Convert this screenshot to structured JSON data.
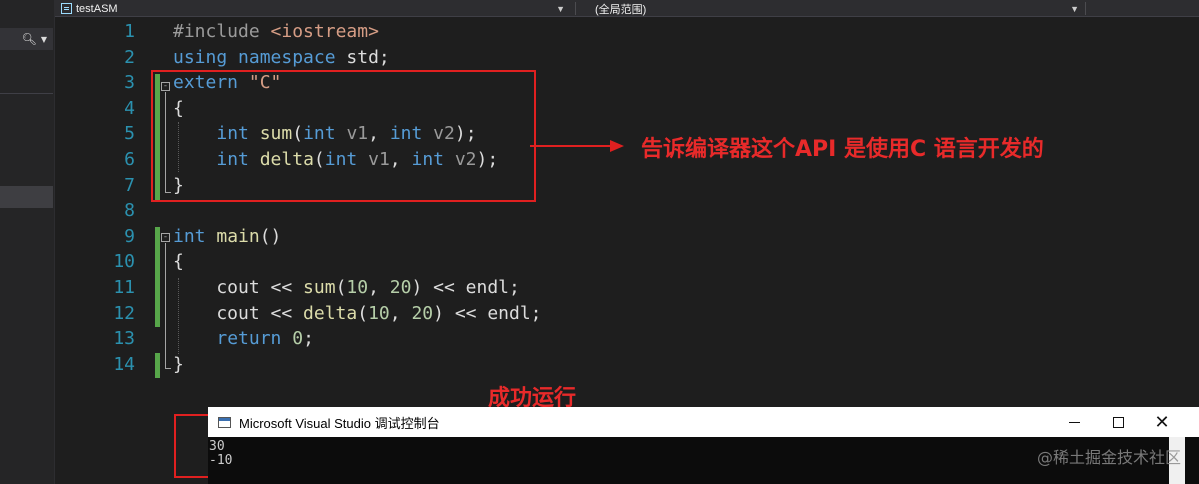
{
  "navbar": {
    "file_combo": "testASM",
    "scope_combo": "(全局范围)"
  },
  "code_lines": [
    {
      "num": "1",
      "tokens": [
        [
          "inc",
          "#include "
        ],
        [
          "str",
          "<iostream>"
        ]
      ]
    },
    {
      "num": "2",
      "tokens": [
        [
          "kw",
          "using"
        ],
        [
          "pl",
          " "
        ],
        [
          "kw",
          "namespace"
        ],
        [
          "pl",
          " std;"
        ]
      ]
    },
    {
      "num": "3",
      "tokens": [
        [
          "kw",
          "extern"
        ],
        [
          "pl",
          " "
        ],
        [
          "str",
          "\"C\""
        ]
      ]
    },
    {
      "num": "4",
      "tokens": [
        [
          "pl",
          "{"
        ]
      ]
    },
    {
      "num": "5",
      "tokens": [
        [
          "pl",
          "    "
        ],
        [
          "kw",
          "int"
        ],
        [
          "pl",
          " "
        ],
        [
          "fn",
          "sum"
        ],
        [
          "pl",
          "("
        ],
        [
          "kw",
          "int"
        ],
        [
          "pl",
          " "
        ],
        [
          "prm",
          "v1"
        ],
        [
          "pl",
          ", "
        ],
        [
          "kw",
          "int"
        ],
        [
          "pl",
          " "
        ],
        [
          "prm",
          "v2"
        ],
        [
          "pl",
          ");"
        ]
      ]
    },
    {
      "num": "6",
      "tokens": [
        [
          "pl",
          "    "
        ],
        [
          "kw",
          "int"
        ],
        [
          "pl",
          " "
        ],
        [
          "fn",
          "delta"
        ],
        [
          "pl",
          "("
        ],
        [
          "kw",
          "int"
        ],
        [
          "pl",
          " "
        ],
        [
          "prm",
          "v1"
        ],
        [
          "pl",
          ", "
        ],
        [
          "kw",
          "int"
        ],
        [
          "pl",
          " "
        ],
        [
          "prm",
          "v2"
        ],
        [
          "pl",
          ");"
        ]
      ]
    },
    {
      "num": "7",
      "tokens": [
        [
          "pl",
          "}"
        ]
      ]
    },
    {
      "num": "8",
      "tokens": []
    },
    {
      "num": "9",
      "tokens": [
        [
          "kw",
          "int"
        ],
        [
          "pl",
          " "
        ],
        [
          "fn",
          "main"
        ],
        [
          "pl",
          "()"
        ]
      ]
    },
    {
      "num": "10",
      "tokens": [
        [
          "pl",
          "{"
        ]
      ]
    },
    {
      "num": "11",
      "tokens": [
        [
          "pl",
          "    cout << "
        ],
        [
          "fn",
          "sum"
        ],
        [
          "pl",
          "("
        ],
        [
          "num",
          "10"
        ],
        [
          "pl",
          ", "
        ],
        [
          "num",
          "20"
        ],
        [
          "pl",
          ") << endl;"
        ]
      ]
    },
    {
      "num": "12",
      "tokens": [
        [
          "pl",
          "    cout << "
        ],
        [
          "fn",
          "delta"
        ],
        [
          "pl",
          "("
        ],
        [
          "num",
          "10"
        ],
        [
          "pl",
          ", "
        ],
        [
          "num",
          "20"
        ],
        [
          "pl",
          ") << endl;"
        ]
      ]
    },
    {
      "num": "13",
      "tokens": [
        [
          "pl",
          "    "
        ],
        [
          "kw",
          "return"
        ],
        [
          "pl",
          " "
        ],
        [
          "num",
          "0"
        ],
        [
          "pl",
          ";"
        ]
      ]
    },
    {
      "num": "14",
      "tokens": [
        [
          "pl",
          "}"
        ]
      ]
    }
  ],
  "annotations": {
    "extern_note": "告诉编译器这个API 是使用C 语言开发的",
    "success_note": "成功运行"
  },
  "console": {
    "title": "Microsoft Visual Studio 调试控制台",
    "output": [
      "30",
      "-10"
    ]
  },
  "watermark": "@稀土掘金技术社区",
  "colors": {
    "keyword": "#569cd6",
    "string": "#d69d85",
    "function": "#dcdcaa",
    "number": "#b5cea8",
    "parameter": "#9a9a9a",
    "line_number": "#2b91af",
    "annotation_red": "#e02020",
    "change_bar_green": "#57a64a"
  },
  "icons": [
    "search-icon",
    "chevron-down-icon",
    "file-icon",
    "collapse-icon",
    "minimize-icon",
    "maximize-icon",
    "close-icon"
  ]
}
